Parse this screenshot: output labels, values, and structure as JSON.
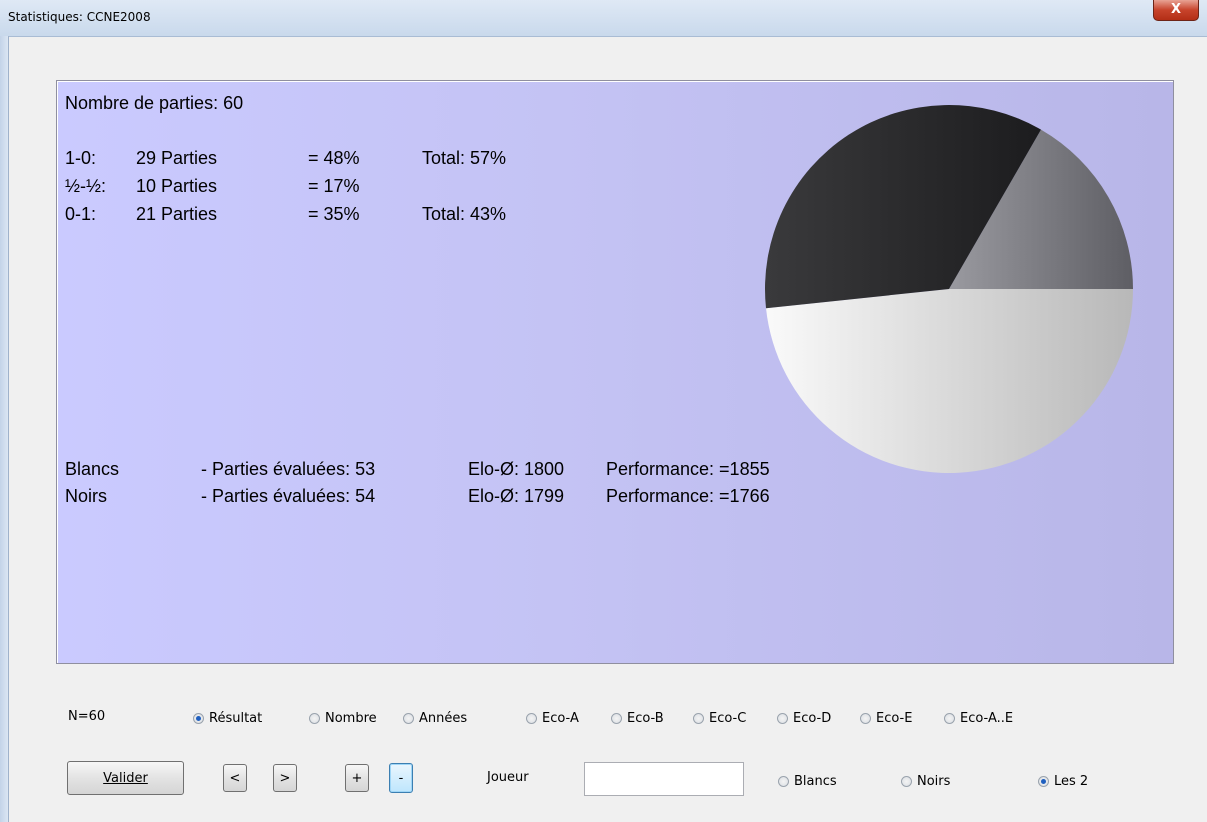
{
  "window": {
    "title": "Statistiques: CCNE2008",
    "close_label": "X"
  },
  "stats": {
    "games_count": "Nombre de parties: 60",
    "results": [
      {
        "label": "1-0:",
        "games": "29 Parties",
        "pct": "= 48%",
        "total": "Total: 57%"
      },
      {
        "label": "½-½:",
        "games": "10 Parties",
        "pct": "= 17%",
        "total": ""
      },
      {
        "label": "0-1:",
        "games": "21 Parties",
        "pct": "= 35%",
        "total": "Total: 43%"
      }
    ],
    "players": [
      {
        "side": "Blancs",
        "evaluated": "- Parties évaluées: 53",
        "elo": "Elo-Ø: 1800",
        "perf": "Performance: =1855"
      },
      {
        "side": "Noirs",
        "evaluated": "- Parties évaluées: 54",
        "elo": "Elo-Ø: 1799",
        "perf": "Performance: =1766"
      }
    ]
  },
  "chart_data": {
    "type": "pie",
    "slices": [
      {
        "result": "1-0",
        "value": 29,
        "percent": 48,
        "color": "#e0e0e0"
      },
      {
        "result": "½-½",
        "value": 10,
        "percent": 17,
        "color": "#7a7a80"
      },
      {
        "result": "0-1",
        "value": 21,
        "percent": 35,
        "color": "#2e2e30"
      }
    ]
  },
  "controls": {
    "n_label": "N=60",
    "mode_options": [
      {
        "label": "Résultat",
        "selected": true
      },
      {
        "label": "Nombre",
        "selected": false
      },
      {
        "label": "Années",
        "selected": false
      },
      {
        "label": "Eco-A",
        "selected": false
      },
      {
        "label": "Eco-B",
        "selected": false
      },
      {
        "label": "Eco-C",
        "selected": false
      },
      {
        "label": "Eco-D",
        "selected": false
      },
      {
        "label": "Eco-E",
        "selected": false
      },
      {
        "label": "Eco-A..E",
        "selected": false
      }
    ],
    "validate_label": "Valider",
    "prev_label": "<",
    "next_label": ">",
    "plus_label": "+",
    "minus_label": "-",
    "player_label": "Joueur",
    "player_value": "",
    "side_options": [
      {
        "label": "Blancs",
        "selected": false
      },
      {
        "label": "Noirs",
        "selected": false
      },
      {
        "label": "Les 2",
        "selected": true
      }
    ]
  }
}
